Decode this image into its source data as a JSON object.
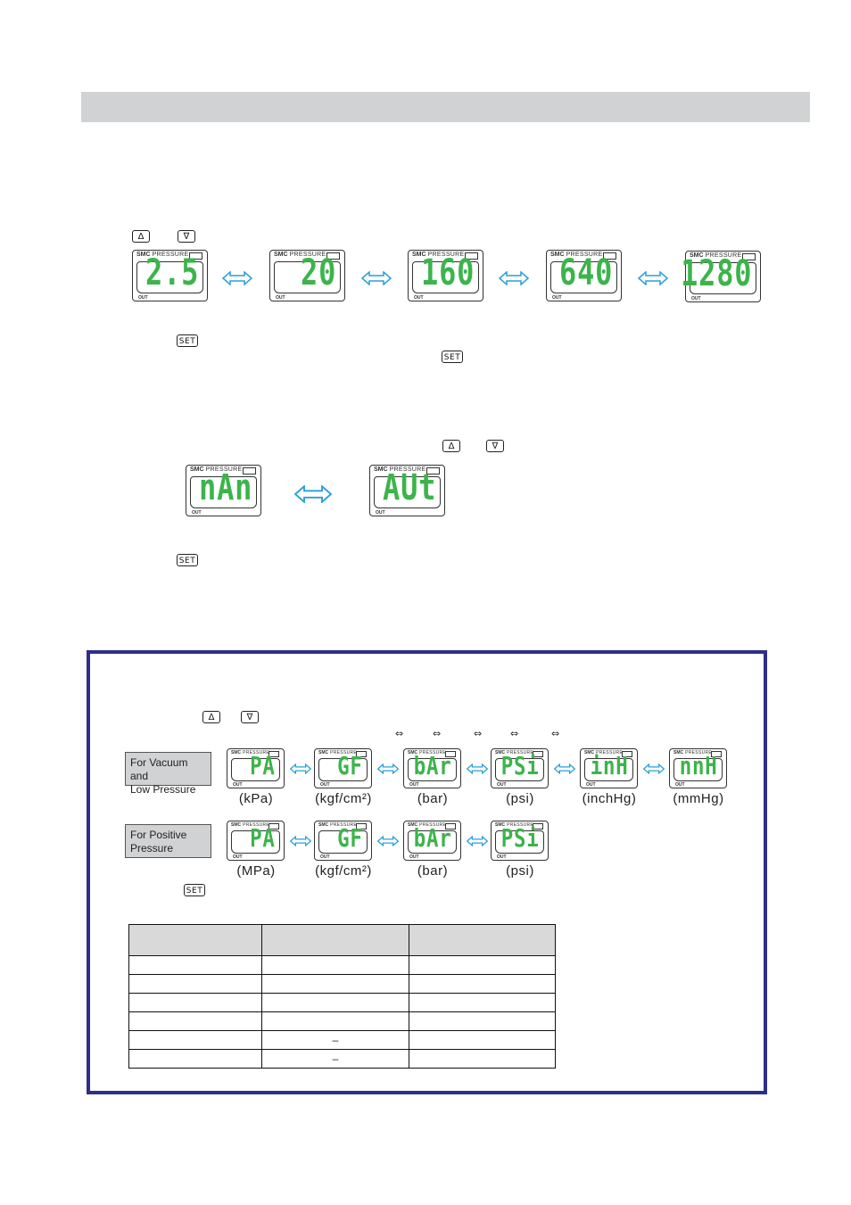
{
  "page": {
    "header_bar": ""
  },
  "keys": {
    "up": "Δ",
    "down": "∇",
    "set": "SET"
  },
  "lcd_common": {
    "brand": "SMC",
    "label": "PRESSURE",
    "out": "OUT"
  },
  "section1": {
    "displays": [
      "2.5",
      "20",
      "160",
      "640",
      "1280"
    ]
  },
  "section2": {
    "displays": [
      "nAn",
      "AUt"
    ]
  },
  "unit_box": {
    "arrows": [
      "⇔",
      "⇔",
      "⇔",
      "⇔",
      "⇔"
    ],
    "vacuum": {
      "label": "For Vacuum and Low Pressure",
      "label_line1": "For Vacuum and",
      "label_line2": "Low Pressure",
      "displays": [
        {
          "code": "PA",
          "unit": "(kPa)"
        },
        {
          "code": "GF",
          "unit": "(kgf/cm²)"
        },
        {
          "code": "bAr",
          "unit": "(bar)"
        },
        {
          "code": "PSi",
          "unit": "(psi)"
        },
        {
          "code": "inH",
          "unit": "(inchHg)"
        },
        {
          "code": "nnH",
          "unit": "(mmHg)"
        }
      ]
    },
    "positive": {
      "label": "For Positive Pressure",
      "label_line1": "For Positive",
      "label_line2": "Pressure",
      "displays": [
        {
          "code": "PA",
          "unit": "(MPa)"
        },
        {
          "code": "GF",
          "unit": "(kgf/cm²)"
        },
        {
          "code": "bAr",
          "unit": "(bar)"
        },
        {
          "code": "PSi",
          "unit": "(psi)"
        }
      ]
    },
    "table": {
      "headers": [
        "",
        "",
        ""
      ],
      "rows": [
        [
          "",
          "",
          ""
        ],
        [
          "",
          "",
          ""
        ],
        [
          "",
          "",
          ""
        ],
        [
          "",
          "",
          ""
        ],
        [
          "",
          "–",
          ""
        ],
        [
          "",
          "–",
          ""
        ]
      ]
    }
  },
  "colors": {
    "lcd_digit": "#3cb44b",
    "arrow_blue": "#2a9fd8",
    "frame_border": "#2e2e8a",
    "header_gray": "#d1d2d4"
  }
}
